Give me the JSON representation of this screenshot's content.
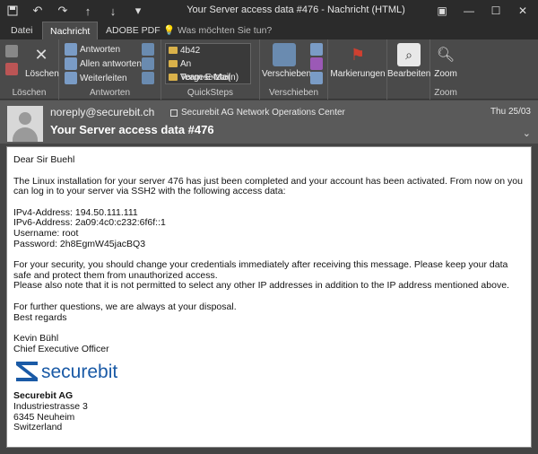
{
  "window": {
    "title": "Your Server access data #476  -  Nachricht (HTML)",
    "quick_access": [
      "save-icon",
      "undo-icon",
      "redo-icon",
      "up-arrow-icon",
      "down-arrow-icon"
    ],
    "controls": [
      "ribbon-display-icon",
      "minimize-icon",
      "maximize-icon",
      "close-icon"
    ]
  },
  "tabs": {
    "items": [
      "Datei",
      "Nachricht",
      "ADOBE PDF"
    ],
    "active": "Nachricht",
    "tellme": "Was möchten Sie tun?"
  },
  "ribbon": {
    "groups": {
      "loeschen": "Löschen",
      "antworten": "Antworten",
      "quicksteps": "QuickSteps",
      "verschieben": "Verschieben",
      "markierungen": "",
      "bearbeiten": "",
      "zoom": "Zoom"
    },
    "delete_label": "Löschen",
    "reply": "Antworten",
    "reply_all": "Allen antworten",
    "forward": "Weiterleiten",
    "quicksteps": [
      "4b42",
      "An Vorgesetzte(n)",
      "Team-E-Mail"
    ],
    "move_label": "Verschieben",
    "flags_label": "Markierungen",
    "edit_label": "Bearbeiten",
    "zoom_label": "Zoom"
  },
  "header": {
    "from": "noreply@securebit.ch",
    "to": "Securebit AG Network Operations Center",
    "date": "Thu 25/03",
    "subject": "Your Server access data #476"
  },
  "message": {
    "greeting": "Dear Sir Buehl",
    "intro": "The Linux installation for your server 476 has just been completed and your account has been activated. From now on you can log in to your server via SSH2 with the following access data:",
    "access": [
      "IPv4-Address: 194.50.111.111",
      "IPv6-Address: 2a09:4c0:c232:6f6f::1",
      "Username: root",
      "Password: 2h8EgmW45jacBQ3"
    ],
    "security": "For your security, you should change your credentials immediately after receiving this message. Please keep your data safe and protect them from unauthorized access.",
    "ip_note": "Please also note that it is not permitted to select any other IP addresses in addition to the IP address mentioned above.",
    "questions": "For further questions, we are always at your disposal.",
    "regards": "Best regards",
    "signer_name": "Kevin Bühl",
    "signer_title": "Chief Executive Officer",
    "logo_text": "securebit",
    "company": "Securebit AG",
    "street": "Industriestrasse 3",
    "city": "6345 Neuheim",
    "country": "Switzerland"
  },
  "colors": {
    "titlebar": "#2b2b2b",
    "ribbon": "#4a4a4a",
    "header": "#5a5a5a",
    "brand": "#1a5aa6",
    "flag": "#d04030"
  }
}
